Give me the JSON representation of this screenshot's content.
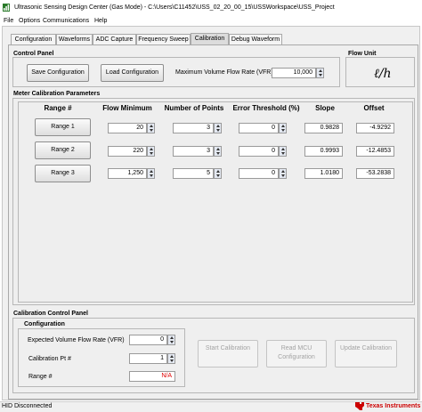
{
  "window": {
    "title": "Ultrasonic Sensing Design Center (Gas Mode) - C:\\Users\\C11452\\USS_02_20_00_15\\USSWorkspace\\USS_Project"
  },
  "menu": [
    "File",
    "Options",
    "Communications",
    "Help"
  ],
  "tabs": [
    {
      "label": "Configuration",
      "active": false
    },
    {
      "label": "Waveforms",
      "active": false
    },
    {
      "label": "ADC Capture",
      "active": false
    },
    {
      "label": "Frequency Sweep",
      "active": false
    },
    {
      "label": "Calibration",
      "active": true
    },
    {
      "label": "Debug Waveform",
      "active": false
    }
  ],
  "control_panel": {
    "title": "Control Panel",
    "save_label": "Save Configuration",
    "load_label": "Load Configuration",
    "vfr_label": "Maximum Volume Flow Rate (VFR)",
    "vfr_value": "10,000"
  },
  "flow_unit": {
    "title": "Flow Unit",
    "value": "ℓ/h"
  },
  "meter_calibration": {
    "title": "Meter Calibration Parameters",
    "columns": [
      "Range #",
      "Flow Minimum",
      "Number of Points",
      "Error Threshold (%)",
      "Slope",
      "Offset"
    ],
    "rows": [
      {
        "label": "Range 1",
        "flow_min": "20",
        "points": "3",
        "threshold": "0",
        "slope": "0.9828",
        "offset": "-4.9292"
      },
      {
        "label": "Range 2",
        "flow_min": "220",
        "points": "3",
        "threshold": "0",
        "slope": "0.9993",
        "offset": "-12.4853"
      },
      {
        "label": "Range 3",
        "flow_min": "1,250",
        "points": "5",
        "threshold": "0",
        "slope": "1.0180",
        "offset": "-53.2838"
      }
    ]
  },
  "calibration_control": {
    "title": "Calibration Control Panel",
    "config_title": "Configuration",
    "expected_vfr_label": "Expected Volume Flow Rate (VFR)",
    "expected_vfr_value": "0",
    "calib_pt_label": "Calibration Pt #",
    "calib_pt_value": "1",
    "range_label": "Range #",
    "range_value": "N/A",
    "start_label": "Start Calibration",
    "read_label": "Read MCU Configuration",
    "update_label": "Update Calibration"
  },
  "status": {
    "text": "HID Disconnected",
    "brand": "Texas Instruments",
    "brand_color": "#cc0000"
  }
}
